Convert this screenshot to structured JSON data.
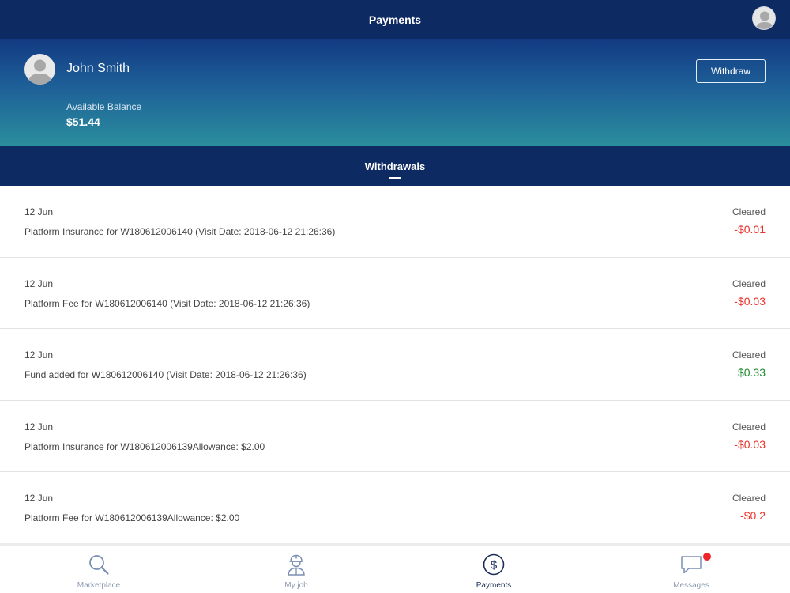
{
  "header": {
    "title": "Payments"
  },
  "profile": {
    "name": "John Smith",
    "balance_label": "Available Balance",
    "balance_value": "$51.44",
    "withdraw_label": "Withdraw"
  },
  "tabs": [
    {
      "label": "Withdrawals",
      "active": true
    }
  ],
  "transactions": [
    {
      "date": "12 Jun",
      "description": "Platform Insurance for W180612006140 (Visit Date: 2018-06-12 21:26:36)",
      "status": "Cleared",
      "amount": "-$0.01",
      "direction": "debit"
    },
    {
      "date": "12 Jun",
      "description": "Platform Fee for W180612006140 (Visit Date: 2018-06-12 21:26:36)",
      "status": "Cleared",
      "amount": "-$0.03",
      "direction": "debit"
    },
    {
      "date": "12 Jun",
      "description": "Fund added for W180612006140 (Visit Date: 2018-06-12 21:26:36)",
      "status": "Cleared",
      "amount": "$0.33",
      "direction": "credit"
    },
    {
      "date": "12 Jun",
      "description": "Platform Insurance for W180612006139Allowance: $2.00",
      "status": "Cleared",
      "amount": "-$0.03",
      "direction": "debit"
    },
    {
      "date": "12 Jun",
      "description": "Platform Fee for W180612006139Allowance: $2.00",
      "status": "Cleared",
      "amount": "-$0.2",
      "direction": "debit"
    }
  ],
  "bottom_nav": [
    {
      "label": "Marketplace",
      "icon": "search-icon",
      "active": false
    },
    {
      "label": "My job",
      "icon": "worker-helmet-icon",
      "active": false
    },
    {
      "label": "Payments",
      "icon": "dollar-circle-icon",
      "active": true
    },
    {
      "label": "Messages",
      "icon": "chat-bubble-icon",
      "active": false,
      "has_notification": true
    }
  ],
  "colors": {
    "navy": "#0e2a63",
    "debit": "#e8332b",
    "credit": "#1f8a2e",
    "notification": "#f0242b"
  }
}
